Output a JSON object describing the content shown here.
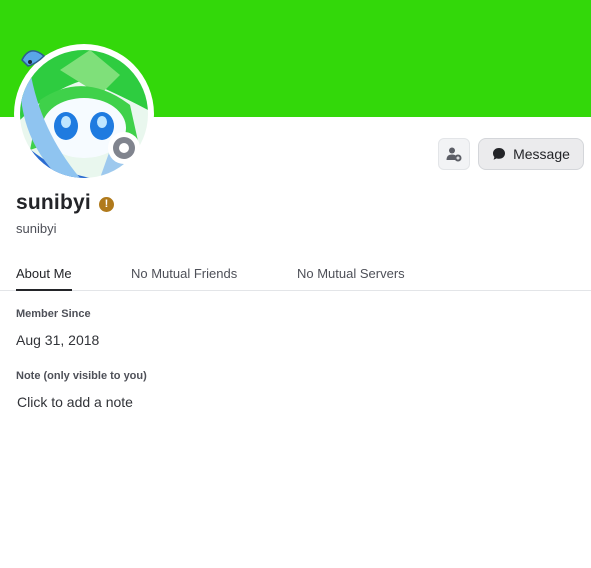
{
  "profile": {
    "display_name": "sunibyi",
    "username": "sunibyi",
    "badge_glyph": "!",
    "status": "offline",
    "banner_color": "#33d80a",
    "status_color": "#80848e",
    "badge_color": "#b07a1c"
  },
  "actions": {
    "friend_icon": "add-friend-icon",
    "message_label": "Message",
    "message_icon": "chat-bubble-icon"
  },
  "tabs": [
    {
      "label": "About Me",
      "active": true
    },
    {
      "label": "No Mutual Friends",
      "active": false
    },
    {
      "label": "No Mutual Servers",
      "active": false
    }
  ],
  "about": {
    "member_since_label": "Member Since",
    "member_since_value": "Aug 31, 2018",
    "note_label": "Note (only visible to you)",
    "note_placeholder": "Click to add a note"
  }
}
